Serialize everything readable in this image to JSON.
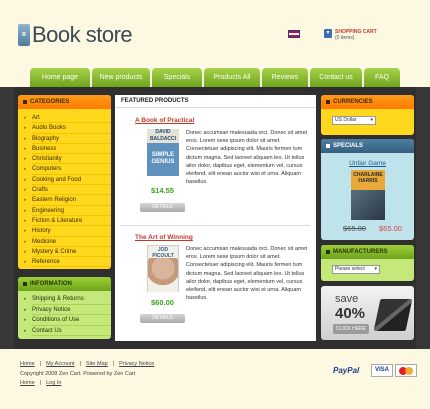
{
  "header": {
    "logo_text": "Book store",
    "cart_label": "SHOPPING CART",
    "cart_count": "(0 items)",
    "language_flag_icon": "uk-flag-icon",
    "cart_icon": "cart-icon"
  },
  "nav": {
    "items": [
      "Home page",
      "New products",
      "Specials",
      "Products All",
      "Reviews",
      "Contact us",
      "FAQ"
    ]
  },
  "categories": {
    "title": "CATEGORIES",
    "items": [
      "Art",
      "Audio Books",
      "Biography",
      "Business",
      "Christianity",
      "Computers",
      "Cooking and Food",
      "Crafts",
      "Eastern Religion",
      "Engineering",
      "Fiction & Literature",
      "History",
      "Medicine",
      "Mystery & Crime",
      "Reference"
    ]
  },
  "information": {
    "title": "INFORMATION",
    "items": [
      "Shipping & Returns",
      "Privacy Notice",
      "Conditions of Use",
      "Contact Us"
    ]
  },
  "featured": {
    "title": "FEATURED PRODUCTS",
    "products": [
      {
        "title": "A Book of Practical",
        "cover_author": "DAVID BALDACCI",
        "cover_title": "SIMPLE GENIUS",
        "price": "$14.55",
        "details_label": "DETAILS",
        "description": "Donec accumsan malesuada orci. Donec sit amet eros. Lorem sese ipsum dolor sit amet. Consectetuer adipiscing elit. Mauris fermen tum dictum magna. Sed laoreet aliquam leo. Ut tellus ailor dolor, dapibus eget, elementum vel, cursus eleifend, elit enean auctor wisi et urna. Aliquam haseilus."
      },
      {
        "title": "The Art of Winning",
        "cover_author": "JOD PICOULT",
        "cover_title": "",
        "price": "$60.00",
        "details_label": "DETAILS",
        "description": "Donec accumsan malesuada orci. Donec sit amet eros. Lorem sese ipsum dolor sit amet. Consectetuer adipiscing elit. Mauris fermen tum dictum magna. Sed laoreet aliquam leo. Ut tellus ailor dolor, dapibus eget, elementum vel, cursus eleifend, elit enean auctor wisi et urna. Aliquam haseilus."
      }
    ]
  },
  "currencies": {
    "title": "CURRENCIES",
    "selected": "US Dollar"
  },
  "specials": {
    "title": "SPECIALS",
    "product_name": "Unfair Game",
    "cover_author": "CHARLAINE HARRIS",
    "old_price": "$65.00",
    "new_price": "$65.00"
  },
  "manufacturers": {
    "title": "MANUFACTURERS",
    "selected": "Please select"
  },
  "promo": {
    "save_label": "save",
    "percent": "40%",
    "button_label": "CLICK HERE"
  },
  "footer": {
    "links": [
      "Home",
      "My Account",
      "Site Map",
      "Privacy Notice"
    ],
    "copyright": "Copyright   2008 Zen Cart. Powered by Zen Cart",
    "links2": [
      "Home",
      "Log In"
    ],
    "payment_paypal": "PayPal",
    "payment_visa": "VISA"
  },
  "colors": {
    "nav_green": "#7cb32a",
    "category_yellow": "#ffd71c",
    "title_orange": "#ff8a00",
    "price_green": "#3f9f1e",
    "link_red": "#c0392b",
    "specials_blue": "#4e7fa3"
  }
}
